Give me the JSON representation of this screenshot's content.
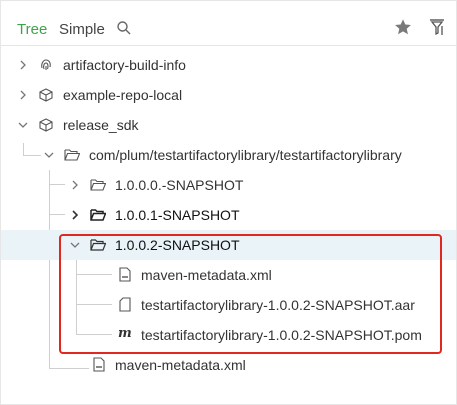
{
  "header": {
    "tab_tree": "Tree",
    "tab_simple": "Simple",
    "icons": [
      "search-icon",
      "star-icon",
      "filter-icon"
    ]
  },
  "tree": {
    "item_build_info": "artifactory-build-info",
    "item_example_repo": "example-repo-local",
    "item_release_sdk": "release_sdk",
    "item_path": "com/plum/testartifactorylibrary/testartifactorylibrary",
    "item_v1000": "1.0.0.0.-SNAPSHOT",
    "item_v1001": "1.0.0.1-SNAPSHOT",
    "item_v1002": "1.0.0.2-SNAPSHOT",
    "item_maven_metadata_inner": "maven-metadata.xml",
    "item_aar": "testartifactorylibrary-1.0.0.2-SNAPSHOT.aar",
    "item_pom": "testartifactorylibrary-1.0.0.2-SNAPSHOT.pom",
    "item_maven_metadata_outer": "maven-metadata.xml"
  },
  "colors": {
    "accent": "#3ea44b",
    "selection": "#e9f3f8",
    "highlight_border": "#e0281e"
  }
}
